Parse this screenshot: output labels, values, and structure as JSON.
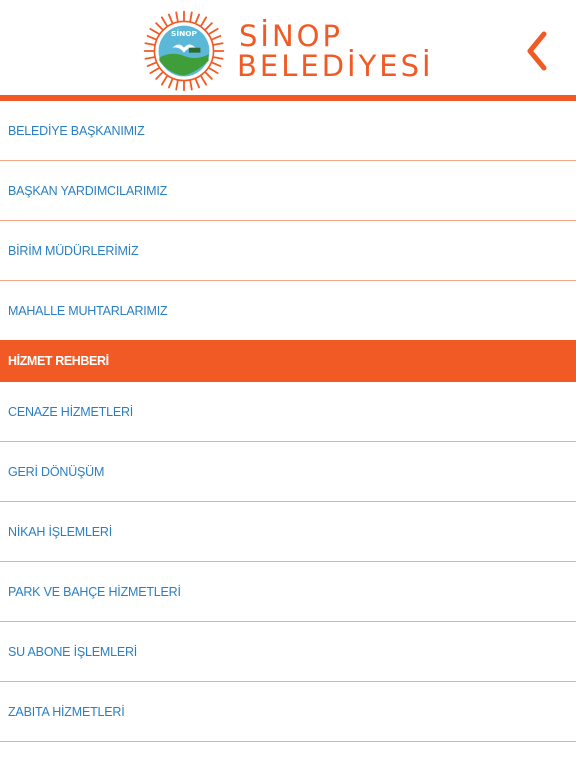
{
  "header": {
    "logo_line1": "SİNOP",
    "logo_line2": "BELEDİYESİ",
    "emblem_icon": "sinop-belediyesi-emblem-icon",
    "back_icon": "chevron-left-icon"
  },
  "colors": {
    "accent": "#f15a24",
    "link": "#2a7fc1",
    "divider": "#f3a98c"
  },
  "menu": {
    "group1": [
      {
        "label": "BELEDİYE BAŞKANIMIZ"
      },
      {
        "label": "BAŞKAN YARDIMCILARIMIZ"
      },
      {
        "label": "BİRİM MÜDÜRLERİMİZ"
      },
      {
        "label": "MAHALLE MUHTARLARIMIZ"
      }
    ],
    "section_header": "HİZMET REHBERİ",
    "group2": [
      {
        "label": "CENAZE HİZMETLERİ"
      },
      {
        "label": "GERİ DÖNÜŞÜM"
      },
      {
        "label": "NİKAH İŞLEMLERİ"
      },
      {
        "label": "PARK VE BAHÇE HİZMETLERİ"
      },
      {
        "label": "SU ABONE İŞLEMLERİ"
      },
      {
        "label": "ZABITA HİZMETLERİ"
      }
    ]
  }
}
